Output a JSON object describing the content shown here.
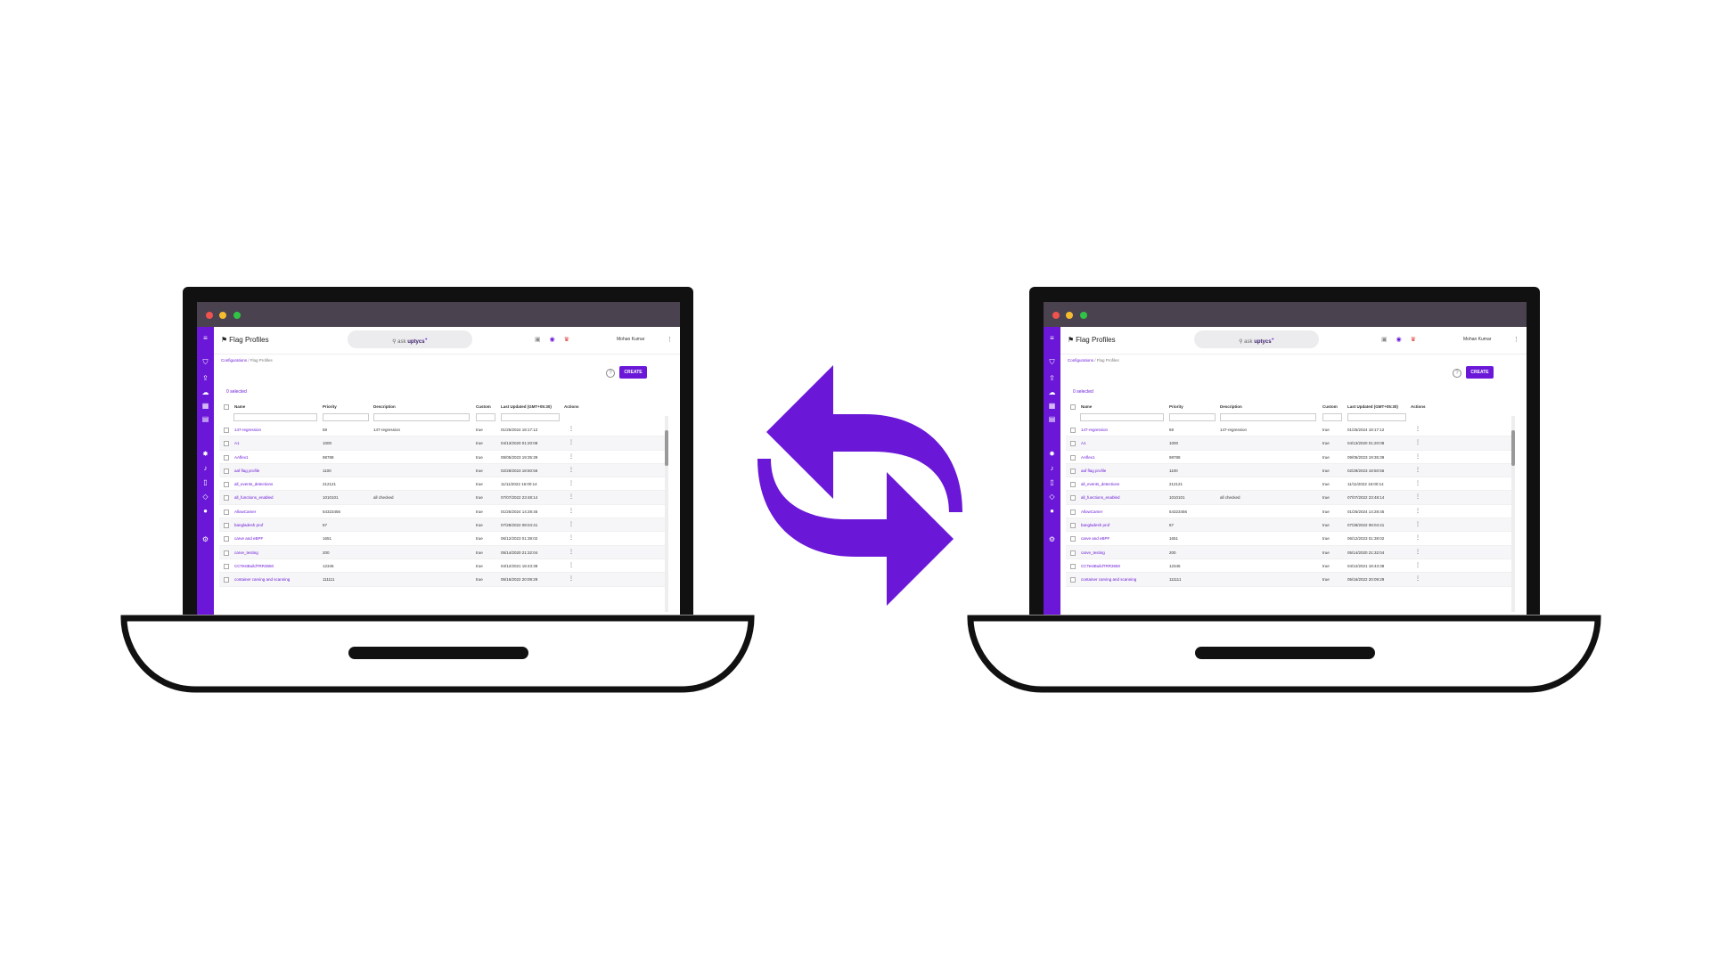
{
  "colors": {
    "accent": "#6a17d8",
    "frame": "#111111",
    "titlebar": "#4b4250"
  },
  "app": {
    "page_title": "Flag Profiles",
    "search_placeholder": "ask",
    "search_brand": "uptycs",
    "user_name": "Mohan Kumar",
    "breadcrumb_parent": "Configurations",
    "breadcrumb_current": "Flag Profiles",
    "create_label": "CREATE",
    "selected_label": "0 selected",
    "columns": {
      "name": "Name",
      "priority": "Priority",
      "description": "Description",
      "custom": "Custom",
      "last_updated": "Last Updated (GMT+05:30)",
      "actions": "Actions"
    },
    "rows": [
      {
        "name": "147-regression",
        "priority": "58",
        "description": "147-regression",
        "custom": "true",
        "updated": "01/25/2024 18:17:12"
      },
      {
        "name": "A1",
        "priority": "1000",
        "description": "",
        "custom": "true",
        "updated": "04/13/2020 01:20:08"
      },
      {
        "name": "AAflex1",
        "priority": "98788",
        "description": "",
        "custom": "true",
        "updated": "09/05/2023 19:35:39"
      },
      {
        "name": "aaf flag profile",
        "priority": "1100",
        "description": "",
        "custom": "true",
        "updated": "02/28/2023 18:50:56"
      },
      {
        "name": "all_events_detections",
        "priority": "212121",
        "description": "",
        "custom": "true",
        "updated": "11/11/2022 16:00:14"
      },
      {
        "name": "all_functions_enabled",
        "priority": "1010101",
        "description": "all checked",
        "custom": "true",
        "updated": "07/07/2022 23:48:14"
      },
      {
        "name": "AllowCamer",
        "priority": "54323456",
        "description": "",
        "custom": "true",
        "updated": "01/25/2024 14:28:45"
      },
      {
        "name": "bangladesh prof",
        "priority": "67",
        "description": "",
        "custom": "true",
        "updated": "07/28/2022 08:04:41"
      },
      {
        "name": "carve and eBPF",
        "priority": "1651",
        "description": "",
        "custom": "true",
        "updated": "06/12/2023 01:38:02"
      },
      {
        "name": "carve_testing",
        "priority": "200",
        "description": "",
        "custom": "true",
        "updated": "05/14/2020 21:32:04"
      },
      {
        "name": "CCTestBuildTRR3650",
        "priority": "12345",
        "description": "",
        "custom": "true",
        "updated": "04/12/2021 18:43:38"
      },
      {
        "name": "container carving and scanning",
        "priority": "111111",
        "description": "",
        "custom": "true",
        "updated": "05/16/2022 20:09:29"
      }
    ]
  },
  "icons": {
    "sidebar": [
      "menu-icon",
      "shield-icon",
      "cloud-upload-icon",
      "cloud-icon",
      "grid-icon",
      "database-icon",
      "bug-icon",
      "bell-icon",
      "document-icon",
      "compass-icon",
      "location-icon",
      "settings-icon"
    ],
    "center": "swap-arrows-icon"
  }
}
